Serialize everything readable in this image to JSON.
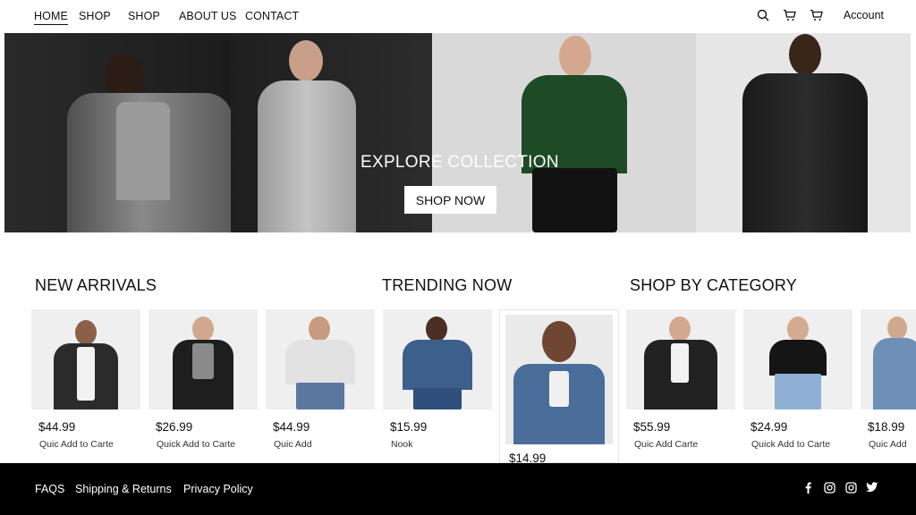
{
  "nav": {
    "items": [
      "HOME",
      "SHOP",
      "SHOP",
      "ABOUT US",
      "CONTACT"
    ],
    "account": "Account",
    "icons": [
      "search-icon",
      "cart-icon",
      "bag-icon"
    ]
  },
  "hero": {
    "title": "EXPLORE COLLECTION",
    "button": "SHOP NOW"
  },
  "sections": {
    "new_arrivals": "NEW ARRIVALS",
    "trending": "TRENDING NOW",
    "category": "SHOP BY CATEGORY"
  },
  "products": [
    {
      "price": "$44.99",
      "action": "Quic Add to Carte"
    },
    {
      "price": "$26.99",
      "action": "Quick Add to Carte"
    },
    {
      "price": "$44.99",
      "action": "Quic Add"
    },
    {
      "price": "$15.99",
      "action": "Nook"
    },
    {
      "price": "$14.99",
      "action": ""
    },
    {
      "price": "$55.99",
      "action": "Quic Add Carte"
    },
    {
      "price": "$24.99",
      "action": "Quick Add to Carte"
    },
    {
      "price": "$18.99",
      "action": "Quic Add"
    }
  ],
  "footer": {
    "links": [
      "FAQS",
      "Shipping & Returns",
      "Privacy Policy"
    ],
    "social": [
      "facebook-icon",
      "instagram-icon",
      "instagram-icon",
      "twitter-icon"
    ]
  },
  "colors": {
    "footer_bg": "#000000",
    "text": "#111111",
    "card_bg": "#efefef"
  }
}
